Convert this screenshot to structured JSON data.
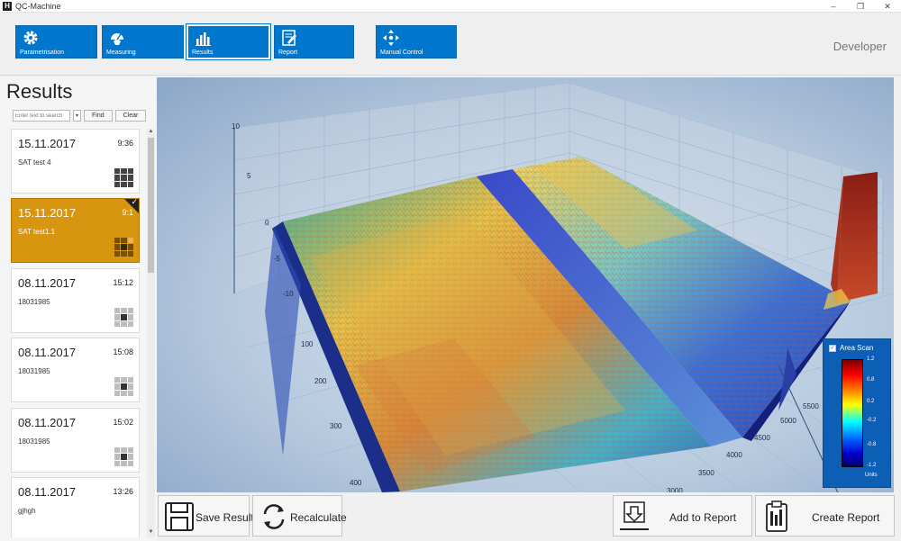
{
  "window": {
    "title": "QC-Machine",
    "controls": [
      "–",
      "❐",
      "✕"
    ]
  },
  "toolbar": {
    "buttons": [
      {
        "label": "Parametrisation",
        "icon": "gear-icon"
      },
      {
        "label": "Measuring",
        "icon": "gauge-icon"
      },
      {
        "label": "Results",
        "icon": "bar-chart-icon"
      },
      {
        "label": "Report",
        "icon": "report-icon"
      },
      {
        "label": "Manual Control",
        "icon": "move-arrows-icon"
      }
    ],
    "active": "Results",
    "user_role": "Developer"
  },
  "results_panel": {
    "title": "Results",
    "search": {
      "placeholder": "Enter text to search",
      "dropdown": "▾",
      "find_label": "Find",
      "clear_label": "Clear"
    },
    "items": [
      {
        "date": "15.11.2017",
        "time": "9:36",
        "name": "SAT test 4",
        "selected": false
      },
      {
        "date": "15.11.2017",
        "time": "9:1",
        "name": "SAT test1.1",
        "selected": true
      },
      {
        "date": "08.11.2017",
        "time": "15:12",
        "name": "18031985",
        "selected": false
      },
      {
        "date": "08.11.2017",
        "time": "15:08",
        "name": "18031985",
        "selected": false
      },
      {
        "date": "08.11.2017",
        "time": "15:02",
        "name": "18031985",
        "selected": false
      },
      {
        "date": "08.11.2017",
        "time": "13:26",
        "name": "gjhgh",
        "selected": false
      }
    ]
  },
  "plot": {
    "type": "3d-surface",
    "series": "Area Scan",
    "legend": {
      "title": "Area Scan",
      "checked": "✓",
      "values": [
        "1.2",
        "0.8",
        "0.2",
        "-0.2",
        "-0.8",
        "-1.2"
      ],
      "units": "Units",
      "colors": [
        "#7a0000",
        "#ff0000",
        "#ff8c00",
        "#ffff00",
        "#00ffff",
        "#0066ff",
        "#00006a"
      ]
    },
    "z_axis_ticks": [
      "10",
      "5",
      "0",
      "-5",
      "-10"
    ],
    "left_axis_ticks": [
      "100",
      "200",
      "300",
      "400"
    ],
    "right_axis_ticks": [
      "5500",
      "5000",
      "4500",
      "4000",
      "3500",
      "3000"
    ],
    "background": "#a9bfd8"
  },
  "actions": {
    "save_label": "Save Result",
    "recalculate_label": "Recalculate",
    "add_report_label": "Add to Report",
    "create_report_label": "Create Report"
  }
}
